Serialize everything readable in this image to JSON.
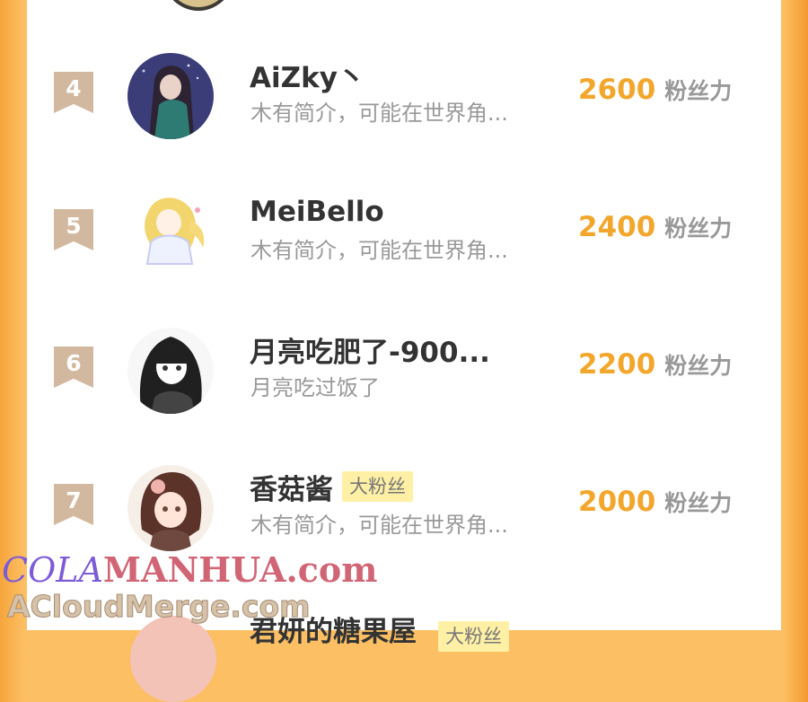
{
  "ranking": {
    "unit_label": "粉丝力",
    "badge_label": "大粉丝",
    "entries": [
      {
        "rank": "4",
        "name": "AiZky丶",
        "description": "木有简介，可能在世界角...",
        "fan_power": "2600",
        "badge": "",
        "avatar_icon": "dark-haired-girl-night-avatar"
      },
      {
        "rank": "5",
        "name": "MeiBello",
        "description": "木有简介，可能在世界角...",
        "fan_power": "2400",
        "badge": "",
        "avatar_icon": "blonde-girl-white-dress-avatar"
      },
      {
        "rank": "6",
        "name": "月亮吃肥了-900...",
        "description": "月亮吃过饭了",
        "fan_power": "2200",
        "badge": "",
        "avatar_icon": "manga-girl-black-hair-avatar"
      },
      {
        "rank": "7",
        "name": "香菇酱",
        "description": "木有简介，可能在世界角...",
        "fan_power": "2000",
        "badge": "大粉丝",
        "avatar_icon": "brown-haired-girl-avatar"
      }
    ],
    "partial_entry": {
      "name": "君妍的糖果屋",
      "badge": "大粉丝"
    }
  },
  "watermark": {
    "line1_part1": "COLA",
    "line1_part2": "MANHUA.com",
    "line2": "ACloudMerge.com"
  },
  "colors": {
    "background_orange": "#fcbf63",
    "fan_power_value": "#f2a62b",
    "rank_badge": "#d3b8a0",
    "fan_badge_bg": "#fff0a6",
    "name_text": "#333333",
    "desc_text": "#999999"
  }
}
